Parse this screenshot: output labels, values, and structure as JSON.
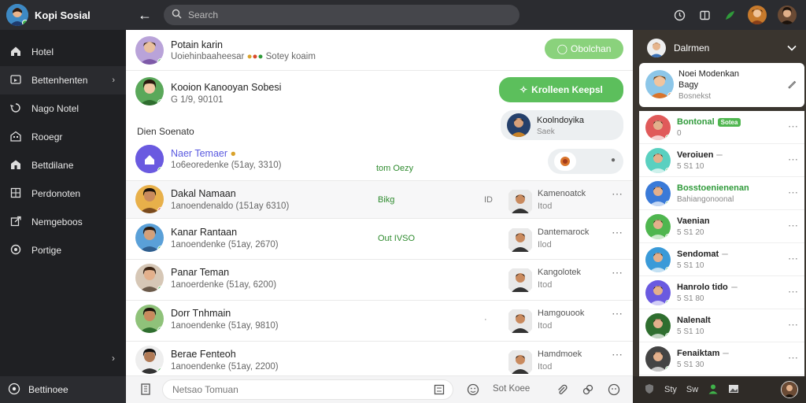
{
  "app": {
    "name": "Kopi Sosial"
  },
  "search": {
    "placeholder": "Search"
  },
  "colors": {
    "accent_green": "#5cbf5c",
    "online": "#3fb24a",
    "busy": "#d9342b",
    "sidebar": "#1f2023"
  },
  "sidebar": {
    "items": [
      {
        "icon": "home-icon",
        "label": "Hotel"
      },
      {
        "icon": "tv-icon",
        "label": "Bettenhenten"
      },
      {
        "icon": "swirl-icon",
        "label": "Nago Notel"
      },
      {
        "icon": "building-icon",
        "label": "Rooegr"
      },
      {
        "icon": "store-icon",
        "label": "Bettdilane"
      },
      {
        "icon": "grid-icon",
        "label": "Perdonoten"
      },
      {
        "icon": "export-icon",
        "label": "Nemgeboos"
      },
      {
        "icon": "circle-icon",
        "label": "Portige"
      }
    ],
    "footer_label": "Bettinoee"
  },
  "chats": {
    "pinned": {
      "name": "Potain karin",
      "subtitle": "Uoiehinbaaheesar",
      "subtitle_tail": "Sotey koaim",
      "bubble": "Obolchan"
    },
    "second": {
      "name": "Kooion Kanooyan Sobesi",
      "subtitle": "G 1/9, 90101",
      "bubble": "Krolleen Keepsl"
    },
    "contact_card": {
      "name": "Koolndoyika",
      "subtitle": "Saek"
    },
    "section_label": "Dien Soenato",
    "new_item": {
      "name": "Naer Temaer",
      "subtitle": "1o6eoredenke (51ay, 3310)",
      "meta": "tom Oezy"
    },
    "rows": [
      {
        "name": "Dakal Namaan",
        "subtitle": "1anoendenaldo (151ay 6310)",
        "meta": "Bikg",
        "meta2": "ID",
        "contact": "Kamenoatck",
        "contact_sub": "Itod"
      },
      {
        "name": "Kanar Rantaan",
        "subtitle": "1anoendenke (51ay, 2670)",
        "meta": "Out IVSO",
        "meta2": "",
        "contact": "Dantemarock",
        "contact_sub": "Ilod"
      },
      {
        "name": "Panar Teman",
        "subtitle": "1anoerdenke (51ay, 6200)",
        "meta": "",
        "meta2": "",
        "contact": "Kangolotek",
        "contact_sub": "Itod"
      },
      {
        "name": "Dorr Tnhmain",
        "subtitle": "1anoendenke (51ay, 9810)",
        "meta": "",
        "meta2": "·",
        "contact": "Hamgouook",
        "contact_sub": "Itod"
      },
      {
        "name": "Berae Fenteoh",
        "subtitle": "1anoendenke (51ay, 2200)",
        "meta": "",
        "meta2": "",
        "contact": "Hamdmoek",
        "contact_sub": "Itod"
      }
    ]
  },
  "composer": {
    "placeholder": "Netsao Tomuan",
    "action_label": "Sot Koee"
  },
  "right_panel": {
    "header": "Dalrmen",
    "card": {
      "line1": "Noei Modenkan",
      "line2": "Bagy",
      "line3": "Bosnekst"
    },
    "items": [
      {
        "name": "Bontonal",
        "sub": "0",
        "tag": "Sotea",
        "tag_color": "#4fb64f"
      },
      {
        "name": "Veroiuen",
        "sub": "5 S1 10",
        "tag": "",
        "tag_color": "#cfcfcf"
      },
      {
        "name": "Bosstoenienenan",
        "sub": "Bahiangonoonal",
        "tag": "",
        "tag_color": ""
      },
      {
        "name": "Vaenian",
        "sub": "5 S1 20",
        "tag": "",
        "tag_color": ""
      },
      {
        "name": "Sendomat",
        "sub": "5 S1 10",
        "tag": "",
        "tag_color": "#cfcfcf"
      },
      {
        "name": "Hanrolo tido",
        "sub": "5 S1 80",
        "tag": "",
        "tag_color": "#cfcfcf"
      },
      {
        "name": "Nalenalt",
        "sub": "5 S1 10",
        "tag": "",
        "tag_color": ""
      },
      {
        "name": "Fenaiktam",
        "sub": "5 S1 30",
        "tag": "",
        "tag_color": "#cfcfcf"
      }
    ],
    "footer": {
      "a": "Sty",
      "b": "Sw"
    }
  }
}
